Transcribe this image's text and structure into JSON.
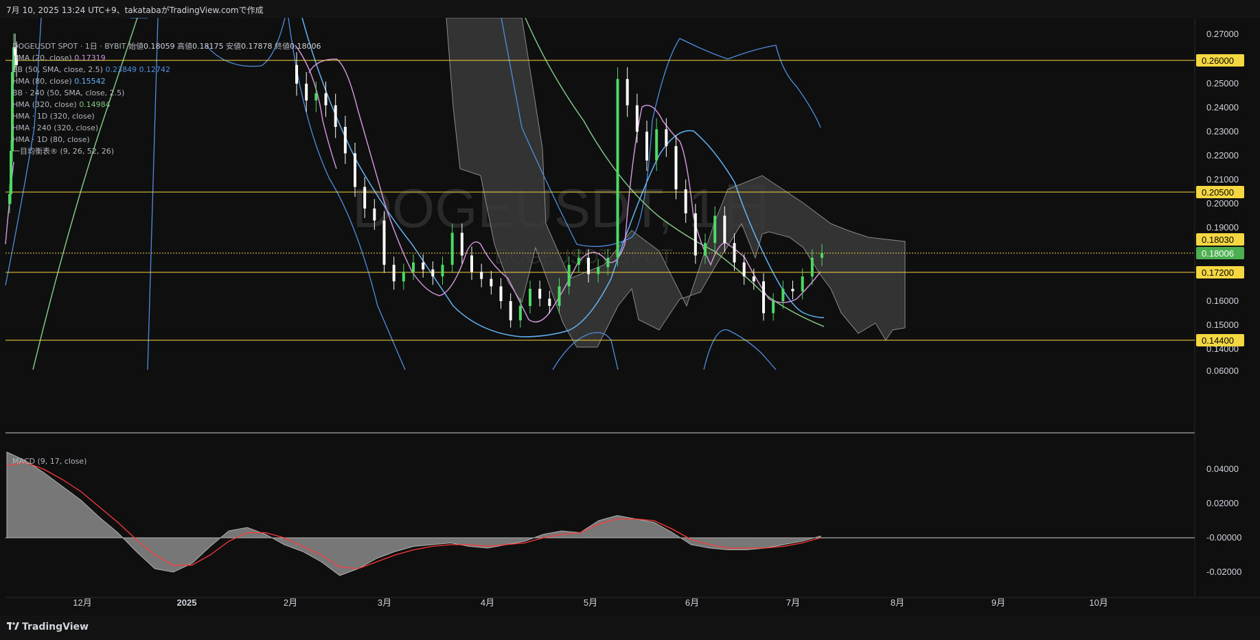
{
  "header": {
    "text": "7月 10, 2025 13:24 UTC+9、takatabaがTradingView.comで作成"
  },
  "footer": {
    "brand": "TradingView",
    "logo_icon": "tradingview-logo-icon"
  },
  "watermark": {
    "main": "DOGEUSDT, 1日",
    "sub": "DOGEUSDT SPOT"
  },
  "legend": {
    "symbol": "DOGEUSDT SPOT · 1日 · BYBIT",
    "ohlc": [
      {
        "label": "始値",
        "value": "0.18059"
      },
      {
        "label": "高値",
        "value": "0.18175"
      },
      {
        "label": "安値",
        "value": "0.17878"
      },
      {
        "label": "終値",
        "value": "0.18006"
      }
    ],
    "indicators": [
      {
        "label": "HMA (20, close)",
        "value": "0.17319",
        "color": "#ce93d8"
      },
      {
        "label": "BB (50, SMA, close, 2.5)",
        "value": "0.23849",
        "value2": "0.12742",
        "color": "#4f8fe0"
      },
      {
        "label": "HMA (80, close)",
        "value": "0.15542",
        "color": "#64b5f6"
      },
      {
        "label": "BB · 240 (50, SMA, close, 2.5)",
        "value": "",
        "color": "#b2b5be"
      },
      {
        "label": "HMA (320, close)",
        "value": "0.14984",
        "color": "#81c784"
      },
      {
        "label": "HMA · 1D (320, close)",
        "value": "",
        "color": "#b2b5be"
      },
      {
        "label": "HMA · 240 (320, close)",
        "value": "",
        "color": "#b2b5be"
      },
      {
        "label": "HMA · 1D (80, close)",
        "value": "",
        "color": "#b2b5be"
      },
      {
        "label": "一目均衡表® (9, 26, 52, 26)",
        "value": "",
        "color": "#b2b5be"
      }
    ],
    "macd_label": "MACD (9, 17, close)"
  },
  "colors": {
    "up": "#4cd964",
    "down": "#ffffff",
    "hma20": "#ce93d8",
    "hma80": "#64b5f6",
    "hma320": "#81c784",
    "bb": "#4f8fe0",
    "cloud": "#5a5a5a",
    "hline": "#f5d742",
    "macd_line": "#ff3b3b",
    "macd_area": "#8a8a8a",
    "axis_text": "#d1d4dc"
  },
  "chart_data": {
    "type": "candlestick",
    "symbol": "DOGEUSDT",
    "timeframe": "1日",
    "x_axis": {
      "tick_labels": [
        "12月",
        "2025",
        "2月",
        "3月",
        "4月",
        "5月",
        "6月",
        "7月",
        "8月",
        "9月",
        "10月"
      ]
    },
    "price_axis": {
      "tick_labels": [
        "0.27000",
        "0.25000",
        "0.24000",
        "0.23000",
        "0.22000",
        "0.21000",
        "0.20000",
        "0.19000",
        "0.16000",
        "0.15000",
        "0.14000",
        "0.06000"
      ],
      "horizontal_levels": [
        "0.26000",
        "0.20500",
        "0.18030",
        "0.17200",
        "0.14400"
      ],
      "last_price": "0.18006"
    },
    "macd_axis": {
      "tick_labels": [
        "0.04000",
        "0.02000",
        "-0.00000",
        "-0.02000"
      ]
    },
    "candles_close": [
      0.204,
      0.222,
      0.255,
      0.265,
      0.262,
      0.258,
      0.25,
      0.243,
      0.246,
      0.241,
      0.232,
      0.221,
      0.207,
      0.198,
      0.193,
      0.175,
      0.168,
      0.172,
      0.176,
      0.173,
      0.17,
      0.175,
      0.188,
      0.179,
      0.172,
      0.169,
      0.166,
      0.16,
      0.152,
      0.158,
      0.165,
      0.161,
      0.158,
      0.166,
      0.175,
      0.178,
      0.171,
      0.174,
      0.178,
      0.252,
      0.241,
      0.23,
      0.218,
      0.231,
      0.224,
      0.206,
      0.196,
      0.179,
      0.184,
      0.195,
      0.184,
      0.176,
      0.17,
      0.168,
      0.155,
      0.16,
      0.165,
      0.164,
      0.17,
      0.178,
      0.18
    ],
    "macd_values": [
      0.05,
      0.045,
      0.038,
      0.03,
      0.022,
      0.012,
      0.003,
      -0.008,
      -0.018,
      -0.02,
      -0.015,
      -0.005,
      0.004,
      0.006,
      0.002,
      -0.004,
      -0.008,
      -0.014,
      -0.022,
      -0.018,
      -0.012,
      -0.008,
      -0.005,
      -0.004,
      -0.003,
      -0.005,
      -0.006,
      -0.004,
      -0.002,
      0.002,
      0.004,
      0.003,
      0.01,
      0.013,
      0.011,
      0.009,
      0.003,
      -0.004,
      -0.006,
      -0.007,
      -0.007,
      -0.006,
      -0.004,
      -0.002,
      0.001
    ],
    "macd_signal": [
      0.042,
      0.044,
      0.04,
      0.034,
      0.027,
      0.018,
      0.009,
      -0.001,
      -0.01,
      -0.016,
      -0.016,
      -0.01,
      -0.002,
      0.003,
      0.003,
      0.0,
      -0.005,
      -0.01,
      -0.017,
      -0.018,
      -0.014,
      -0.01,
      -0.007,
      -0.005,
      -0.004,
      -0.004,
      -0.005,
      -0.004,
      -0.003,
      0.0,
      0.002,
      0.003,
      0.008,
      0.011,
      0.011,
      0.01,
      0.005,
      -0.001,
      -0.004,
      -0.006,
      -0.006,
      -0.006,
      -0.005,
      -0.003,
      0.0
    ]
  }
}
